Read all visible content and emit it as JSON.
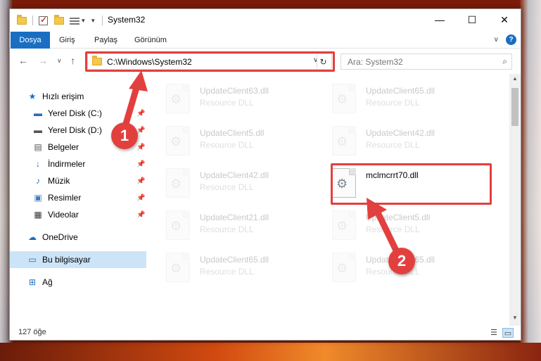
{
  "window": {
    "title": "System32"
  },
  "ribbon": {
    "tabs": [
      "Dosya",
      "Giriş",
      "Paylaş",
      "Görünüm"
    ],
    "help_label": "?"
  },
  "address": {
    "path": "C:\\Windows\\System32"
  },
  "search": {
    "placeholder": "Ara: System32"
  },
  "nav": {
    "items": [
      {
        "label": "Hızlı erişim",
        "icon": "star-icon",
        "pinned": false
      },
      {
        "label": "Yerel Disk (C:)",
        "icon": "drive-icon",
        "pinned": true
      },
      {
        "label": "Yerel Disk (D:)",
        "icon": "drive-icon",
        "pinned": true
      },
      {
        "label": "Belgeler",
        "icon": "documents-icon",
        "pinned": true
      },
      {
        "label": "İndirmeler",
        "icon": "download-icon",
        "pinned": true
      },
      {
        "label": "Müzik",
        "icon": "music-icon",
        "pinned": true
      },
      {
        "label": "Resimler",
        "icon": "pictures-icon",
        "pinned": true
      },
      {
        "label": "Videolar",
        "icon": "videos-icon",
        "pinned": true
      },
      {
        "label": "OneDrive",
        "icon": "cloud-icon",
        "pinned": false
      },
      {
        "label": "Bu bilgisayar",
        "icon": "computer-icon",
        "pinned": false,
        "selected": true
      },
      {
        "label": "Ağ",
        "icon": "network-icon",
        "pinned": false
      }
    ]
  },
  "files": [
    {
      "name": "UpdateClient63.dll",
      "type": "Resource DLL"
    },
    {
      "name": "UpdateClient65.dll",
      "type": "Resource DLL"
    },
    {
      "name": "UpdateClient5.dll",
      "type": "Resource DLL"
    },
    {
      "name": "UpdateClient42.dll",
      "type": "Resource DLL"
    },
    {
      "name": "UpdateClient42.dll",
      "type": "Resource DLL"
    },
    {
      "name": "mclmcrrt70.dll",
      "type": "",
      "highlighted": true
    },
    {
      "name": "UpdateClient21.dll",
      "type": "Resource DLL"
    },
    {
      "name": "UpdateClient5.dll",
      "type": "Resource DLL"
    },
    {
      "name": "UpdateClient65.dll",
      "type": "Resource DLL"
    },
    {
      "name": "UpdateClient65.dll",
      "type": "Resource DLL"
    }
  ],
  "status": {
    "item_count": "127 öğe"
  },
  "annotations": {
    "badge1": "1",
    "badge2": "2",
    "color": "#e2403e"
  }
}
